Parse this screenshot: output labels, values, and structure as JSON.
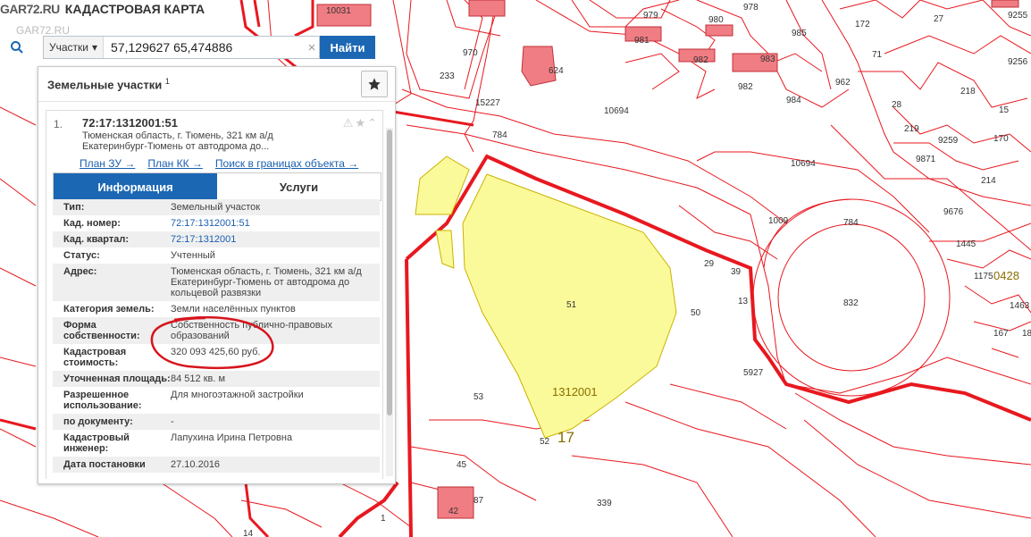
{
  "header": {
    "logo": "GAR72.RU",
    "title": "КАДАСТРОВАЯ КАРТА",
    "watermark": "GAR72.RU"
  },
  "search": {
    "type_label": "Участки",
    "value": "57,129627 65,474886",
    "find_label": "Найти"
  },
  "panel": {
    "title": "Земельные участки",
    "title_sup": "1",
    "result": {
      "num": "1.",
      "id": "72:17:1312001:51",
      "address": "Тюменская область, г. Тюмень, 321 км а/д Екатеринбург-Тюмень от автодрома до...",
      "links": [
        "План ЗУ →",
        "План КК →",
        "Поиск в границах объекта →"
      ]
    },
    "tabs": {
      "info": "Информация",
      "services": "Услуги"
    },
    "attrs": [
      {
        "k": "Тип:",
        "v": "Земельный участок"
      },
      {
        "k": "Кад. номер:",
        "v": "72:17:1312001:51",
        "link": true
      },
      {
        "k": "Кад. квартал:",
        "v": "72:17:1312001",
        "link": true
      },
      {
        "k": "Статус:",
        "v": "Учтенный"
      },
      {
        "k": "Адрес:",
        "v": "Тюменская область, г. Тюмень, 321 км а/д Екатеринбург-Тюмень от автодрома до кольцевой развязки"
      },
      {
        "k": "Категория земель:",
        "v": "Земли населённых пунктов"
      },
      {
        "k": "Форма собственности:",
        "v": "Собственность публично-правовых образований"
      },
      {
        "k": "Кадастровая стоимость:",
        "v": "320 093 425,60 руб."
      },
      {
        "k": "Уточненная площадь:",
        "v": "84 512 кв. м"
      },
      {
        "k": "Разрешенное использование:",
        "v": "Для многоэтажной застройки"
      },
      {
        "k": "по документу:",
        "v": "-"
      },
      {
        "k": "Кадастровый инженер:",
        "v": "Лапухина Ирина Петровна"
      },
      {
        "k": "Дата постановки",
        "v": "27.10.2016"
      }
    ]
  },
  "map": {
    "colors": {
      "boundary": "#e8181f",
      "parcel_fill": "#fbfa9a",
      "building": "#f07d83"
    },
    "labels": [
      "10031",
      "979",
      "980",
      "978",
      "27",
      "9255",
      "172",
      "970",
      "71",
      "233",
      "981",
      "982",
      "983",
      "962",
      "982",
      "15227",
      "624",
      "985",
      "10694",
      "984",
      "28",
      "218",
      "15",
      "9256",
      "784",
      "10694",
      "9259",
      "219",
      "170",
      "9871",
      "214",
      "1009",
      "784",
      "9676",
      "51",
      "29",
      "39",
      "50",
      "13",
      "832",
      "1445",
      "1175",
      "0428",
      "1463",
      "167",
      "18",
      "5927",
      "1312001",
      "53",
      "17",
      "52",
      "45",
      "42",
      "87",
      "339",
      "1",
      "14"
    ]
  }
}
